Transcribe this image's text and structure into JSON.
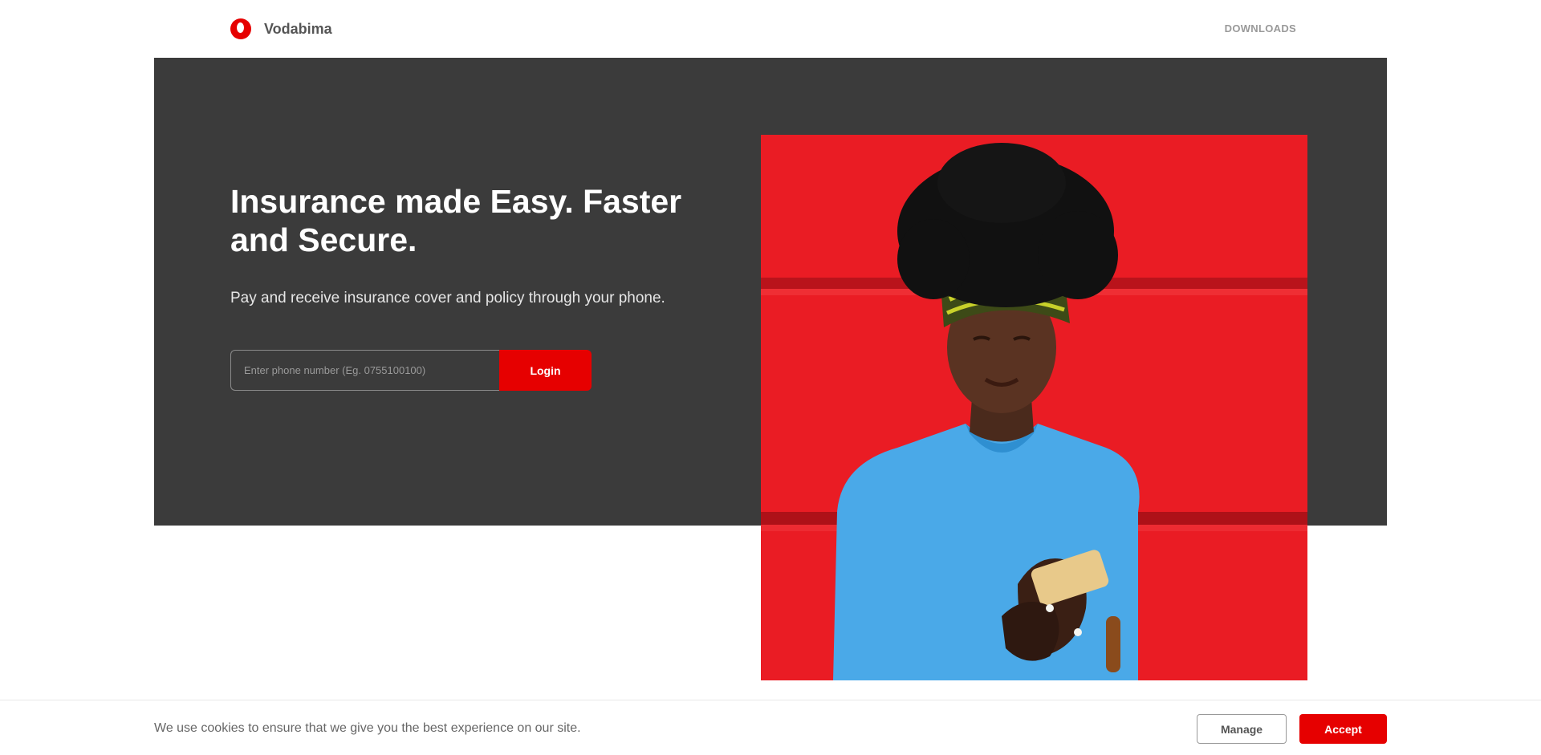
{
  "header": {
    "brand_name": "Vodabima",
    "nav_downloads": "DOWNLOADS"
  },
  "hero": {
    "title": "Insurance made Easy. Faster and Secure.",
    "subtitle": "Pay and receive insurance cover and policy through your phone.",
    "phone_input": {
      "value": "",
      "placeholder": "Enter phone number (Eg. 0755100100)"
    },
    "login_label": "Login"
  },
  "cookie_bar": {
    "text": "We use cookies to ensure that we give you the best experience on our site.",
    "manage_label": "Manage",
    "accept_label": "Accept"
  },
  "colors": {
    "brand_red": "#e60000",
    "hero_background": "#3b3b3b",
    "image_background": "#ea1c24",
    "shirt_blue": "#4aa9e8"
  },
  "icons": {
    "logo": "vodafone-speechmark-logo-icon"
  }
}
